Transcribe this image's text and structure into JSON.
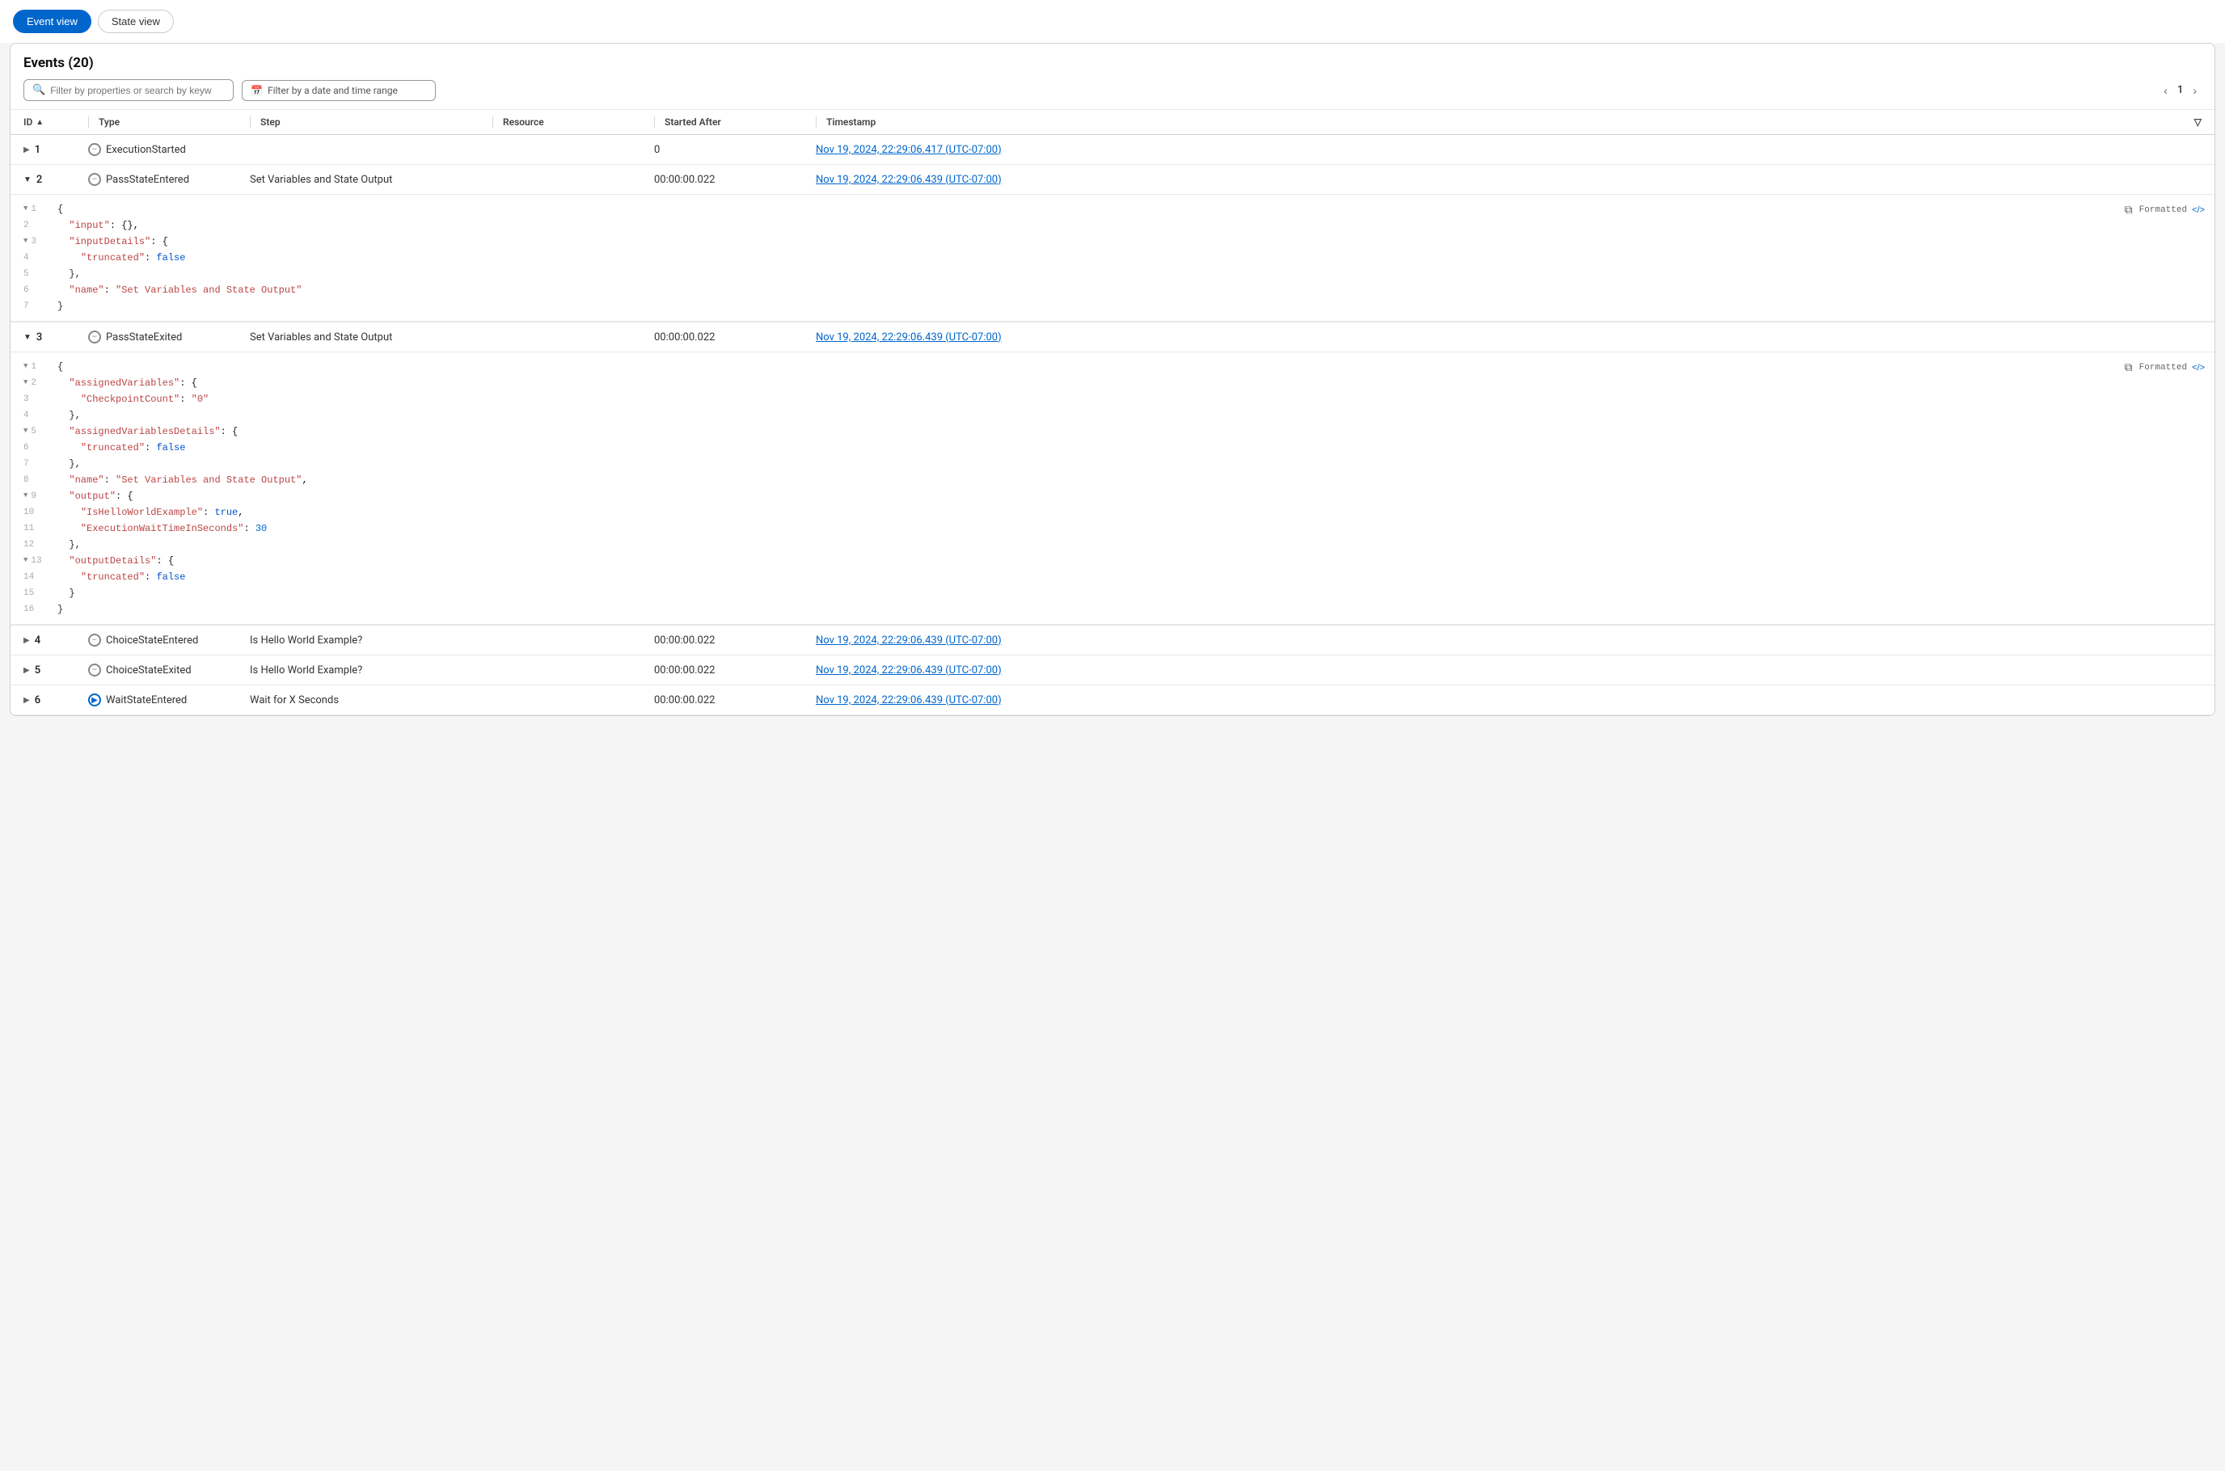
{
  "tabs": [
    {
      "label": "Event view",
      "active": true
    },
    {
      "label": "State view",
      "active": false
    }
  ],
  "panel": {
    "title": "Events",
    "count": 20,
    "filter_placeholder": "Filter by properties or search by keywo.",
    "date_filter_placeholder": "Filter by a date and time range",
    "page_current": 1
  },
  "columns": [
    {
      "label": "ID",
      "key": "id",
      "sort": true
    },
    {
      "label": "Type",
      "key": "type"
    },
    {
      "label": "Step",
      "key": "step"
    },
    {
      "label": "Resource",
      "key": "resource"
    },
    {
      "label": "Started After",
      "key": "started_after"
    },
    {
      "label": "Timestamp",
      "key": "timestamp",
      "filter": true
    }
  ],
  "events": [
    {
      "id": 1,
      "expanded": false,
      "type": "ExecutionStarted",
      "type_icon": "circle-minus",
      "step": "",
      "resource": "",
      "started_after": "0",
      "timestamp": "Nov 19, 2024, 22:29:06.417 (UTC-07:00)"
    },
    {
      "id": 2,
      "expanded": true,
      "type": "PassStateEntered",
      "type_icon": "circle-minus",
      "step": "Set Variables and State Output",
      "resource": "",
      "started_after": "00:00:00.022",
      "timestamp": "Nov 19, 2024, 22:29:06.439 (UTC-07:00)",
      "code": [
        {
          "line": 1,
          "collapse": true,
          "content": "{"
        },
        {
          "line": 2,
          "content": "  \"input\": {},"
        },
        {
          "line": 3,
          "collapse": true,
          "content": "  \"inputDetails\": {"
        },
        {
          "line": 4,
          "content": "    \"truncated\": false"
        },
        {
          "line": 5,
          "content": "  },"
        },
        {
          "line": 6,
          "content": "  \"name\": \"Set Variables and State Output\""
        },
        {
          "line": 7,
          "content": "}"
        }
      ]
    },
    {
      "id": 3,
      "expanded": true,
      "type": "PassStateExited",
      "type_icon": "circle-minus",
      "step": "Set Variables and State Output",
      "resource": "",
      "started_after": "00:00:00.022",
      "timestamp": "Nov 19, 2024, 22:29:06.439 (UTC-07:00)",
      "code": [
        {
          "line": 1,
          "collapse": true,
          "content": "{"
        },
        {
          "line": 2,
          "collapse": true,
          "content": "  \"assignedVariables\": {"
        },
        {
          "line": 3,
          "content": "    \"CheckpointCount\": \"0\""
        },
        {
          "line": 4,
          "content": "  },"
        },
        {
          "line": 5,
          "collapse": true,
          "content": "  \"assignedVariablesDetails\": {"
        },
        {
          "line": 6,
          "content": "    \"truncated\": false"
        },
        {
          "line": 7,
          "content": "  },"
        },
        {
          "line": 8,
          "content": "  \"name\": \"Set Variables and State Output\","
        },
        {
          "line": 9,
          "collapse": true,
          "content": "  \"output\": {"
        },
        {
          "line": 10,
          "content": "    \"IsHelloWorldExample\": true,"
        },
        {
          "line": 11,
          "content": "    \"ExecutionWaitTimeInSeconds\": 30"
        },
        {
          "line": 12,
          "content": "  },"
        },
        {
          "line": 13,
          "collapse": true,
          "content": "  \"outputDetails\": {"
        },
        {
          "line": 14,
          "content": "    \"truncated\": false"
        },
        {
          "line": 15,
          "content": "  }"
        },
        {
          "line": 16,
          "content": "}"
        }
      ]
    },
    {
      "id": 4,
      "expanded": false,
      "type": "ChoiceStateEntered",
      "type_icon": "circle-minus",
      "step": "Is Hello World Example?",
      "resource": "",
      "started_after": "00:00:00.022",
      "timestamp": "Nov 19, 2024, 22:29:06.439 (UTC-07:00)"
    },
    {
      "id": 5,
      "expanded": false,
      "type": "ChoiceStateExited",
      "type_icon": "circle-minus",
      "step": "Is Hello World Example?",
      "resource": "",
      "started_after": "00:00:00.022",
      "timestamp": "Nov 19, 2024, 22:29:06.439 (UTC-07:00)"
    },
    {
      "id": 6,
      "expanded": false,
      "type": "WaitStateEntered",
      "type_icon": "circle-play",
      "step": "Wait for X Seconds",
      "resource": "",
      "started_after": "00:00:00.022",
      "timestamp": "Nov 19, 2024, 22:29:06.439 (UTC-07:00)"
    }
  ],
  "icons": {
    "search": "🔍",
    "calendar": "📅",
    "chevron_left": "‹",
    "chevron_right": "›",
    "copy": "⧉",
    "sort_asc": "▲",
    "filter_down": "▽",
    "expand_right": "▶",
    "expand_down": "▼",
    "code_tag": "</>"
  }
}
